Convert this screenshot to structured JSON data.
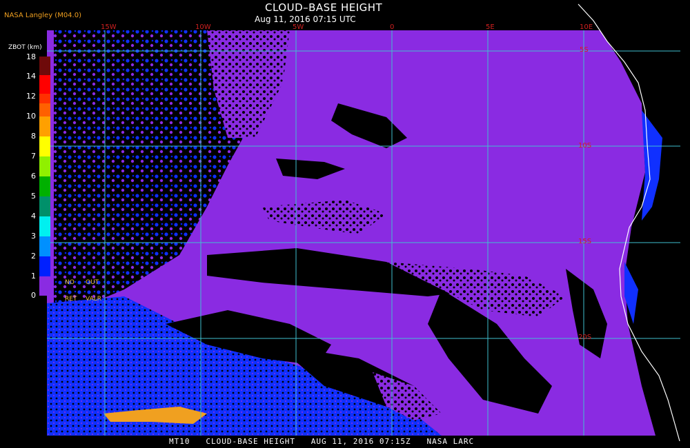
{
  "header": {
    "producer": "NASA Langley (M04.0)",
    "title": "CLOUD–BASE HEIGHT",
    "subtitle": "Aug 11, 2016 07:15 UTC"
  },
  "footer": {
    "text": "MT10   CLOUD-BASE HEIGHT   AUG 11, 2016 07:15Z   NASA LARC"
  },
  "map": {
    "longitude_labels": [
      "15W",
      "10W",
      "5W",
      "0",
      "5E",
      "10E"
    ],
    "latitude_labels": [
      "5S",
      "10S",
      "15S",
      "20S"
    ],
    "colors": {
      "ocean_cloud": "#8a2be2",
      "clear": "#000000",
      "low_cloud": "#1030ff",
      "gridline": "#40c0d0",
      "coastline": "#ffffff",
      "label_red": "#d02020"
    }
  },
  "legend": {
    "unit_label": "ZBOT (km)",
    "ticks": [
      "18",
      "14",
      "12",
      "10",
      "8",
      "7",
      "6",
      "5",
      "4",
      "3",
      "2",
      "1",
      "0"
    ],
    "colors": [
      "#6e0a0a",
      "#8b0000",
      "#ff0000",
      "#ff5000",
      "#ff9000",
      "#ffd000",
      "#ffff00",
      "#c0ff00",
      "#40c000",
      "#00a000",
      "#009060",
      "#00f0f0",
      "#0090ff",
      "#0020ff",
      "#8a2be2"
    ],
    "notes": {
      "no": "NO",
      "out": "OUT",
      "ret": "RET",
      "valr": "VALR"
    }
  }
}
